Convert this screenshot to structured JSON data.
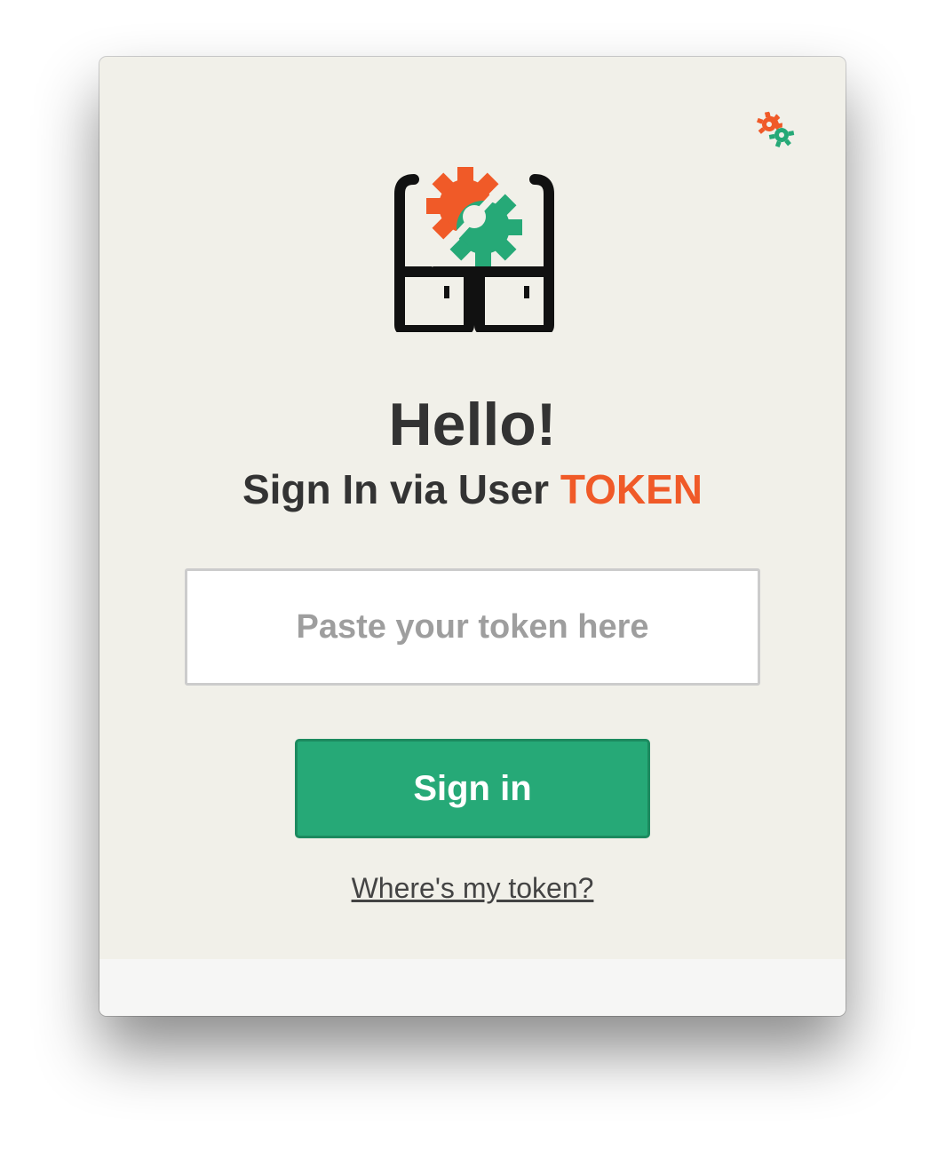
{
  "header": {
    "corner_icon": "gears-icon",
    "logo_icon": "storage-gears-logo"
  },
  "greeting": {
    "title": "Hello!",
    "subtitle_prefix": "Sign In via User",
    "subtitle_accent": "TOKEN"
  },
  "form": {
    "token_placeholder": "Paste your token here",
    "token_value": "",
    "submit_label": "Sign in",
    "help_link": "Where's my token?"
  },
  "colors": {
    "accent_orange": "#f05a28",
    "accent_green": "#26a977",
    "background": "#f1f0e9",
    "text": "#333333"
  }
}
